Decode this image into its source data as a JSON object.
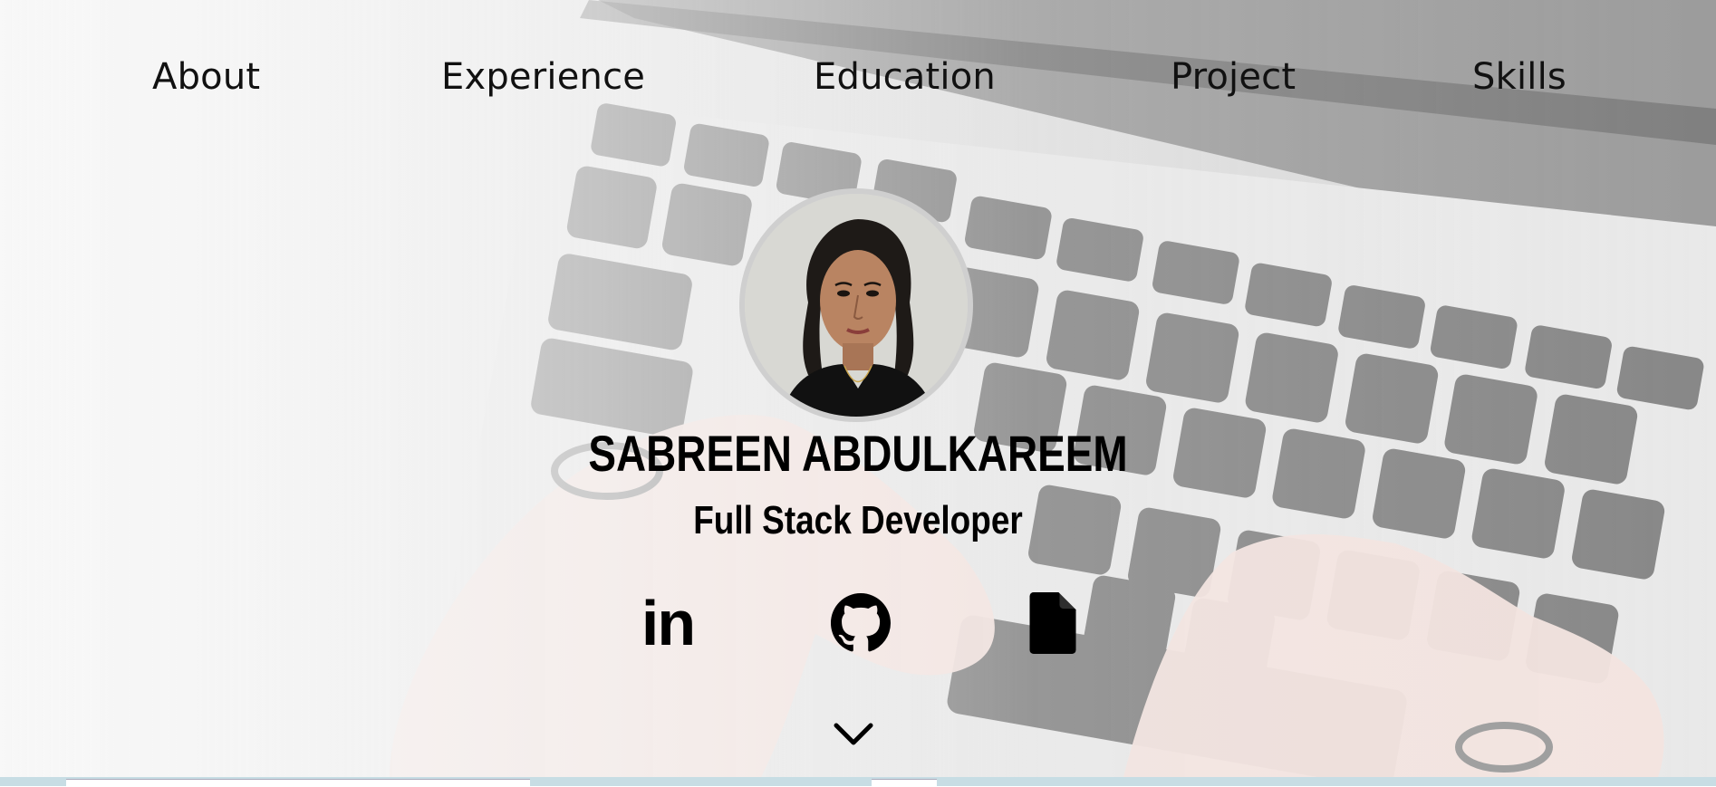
{
  "nav": {
    "items": [
      {
        "label": "About"
      },
      {
        "label": "Experience"
      },
      {
        "label": "Education"
      },
      {
        "label": "Project"
      },
      {
        "label": "Skills"
      }
    ]
  },
  "profile": {
    "name": "SABREEN ABDULKAREEM",
    "role": "Full Stack Developer"
  },
  "social": {
    "linkedin_text": "in",
    "icons": [
      "linkedin-icon",
      "github-icon",
      "resume-file-icon"
    ]
  },
  "colors": {
    "text": "#111111",
    "avatar_border": "#cfcfcf",
    "taskbar": "#c7dde4"
  }
}
